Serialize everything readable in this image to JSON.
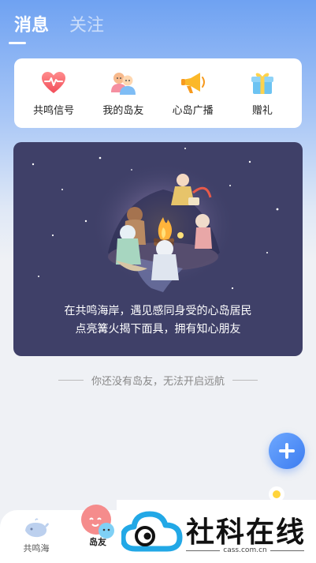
{
  "header": {
    "tabs": [
      {
        "label": "消息",
        "active": true
      },
      {
        "label": "关注",
        "active": false
      }
    ]
  },
  "quick_actions": [
    {
      "label": "共鸣信号",
      "icon": "heart-pulse-icon"
    },
    {
      "label": "我的岛友",
      "icon": "friends-icon"
    },
    {
      "label": "心岛广播",
      "icon": "megaphone-icon"
    },
    {
      "label": "赠礼",
      "icon": "gift-icon"
    }
  ],
  "banner": {
    "line1": "在共鸣海岸，遇见感同身受的心岛居民",
    "line2": "点亮篝火揭下面具，拥有知心朋友"
  },
  "empty_note": "你还没有岛友，无法开启远航",
  "bottom_nav": {
    "items": [
      {
        "label": "共鸣海",
        "icon": "whale-icon",
        "active": false
      },
      {
        "label": "岛友",
        "icon": "bubble-face-icon",
        "active": true
      }
    ]
  },
  "watermark": {
    "title": "社科在线",
    "subtitle": "cass.com.cn"
  },
  "colors": {
    "accent": "#3c7cf0",
    "banner_bg": "#3f4068",
    "header_gradient_top": "#6fa2f2"
  }
}
